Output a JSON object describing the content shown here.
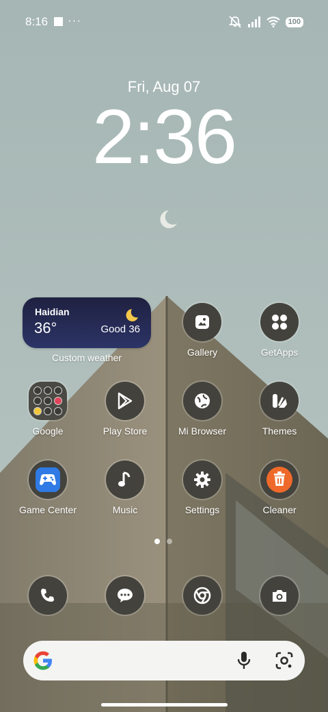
{
  "status_bar": {
    "time": "8:16",
    "more": "···",
    "battery": "100",
    "icons": [
      "notification-square-icon",
      "mute-icon",
      "signal-icon",
      "wifi-icon",
      "battery-icon"
    ]
  },
  "lock_clock": {
    "date": "Fri, Aug 07",
    "time": "2:36"
  },
  "weather_widget": {
    "city": "Haidian",
    "temperature": "36°",
    "air_quality": "Good 36",
    "icon": "crescent-moon-icon",
    "label": "Custom weather"
  },
  "apps": {
    "gallery": {
      "label": "Gallery",
      "icon": "gallery-icon"
    },
    "getapps": {
      "label": "GetApps",
      "icon": "getapps-icon"
    },
    "google": {
      "label": "Google",
      "icon": "folder-icon"
    },
    "playstore": {
      "label": "Play Store",
      "icon": "play-store-icon"
    },
    "mibrowser": {
      "label": "Mi Browser",
      "icon": "globe-icon"
    },
    "themes": {
      "label": "Themes",
      "icon": "themes-icon"
    },
    "gamecenter": {
      "label": "Game Center",
      "icon": "gamepad-icon"
    },
    "music": {
      "label": "Music",
      "icon": "music-note-icon"
    },
    "settings": {
      "label": "Settings",
      "icon": "gear-icon"
    },
    "cleaner": {
      "label": "Cleaner",
      "icon": "trash-icon"
    }
  },
  "dock": [
    "phone-icon",
    "messages-icon",
    "chrome-icon",
    "camera-icon"
  ],
  "page_indicator": {
    "pages": 2,
    "active": 1
  },
  "search_bar": {
    "icons": [
      "google-g-icon",
      "mic-icon",
      "lens-icon"
    ]
  },
  "colors": {
    "icon_bg": "#43423c",
    "weather_bg": "#232a55",
    "cleaner_accent": "#ef6a2a",
    "game_accent": "#3b82f6"
  }
}
